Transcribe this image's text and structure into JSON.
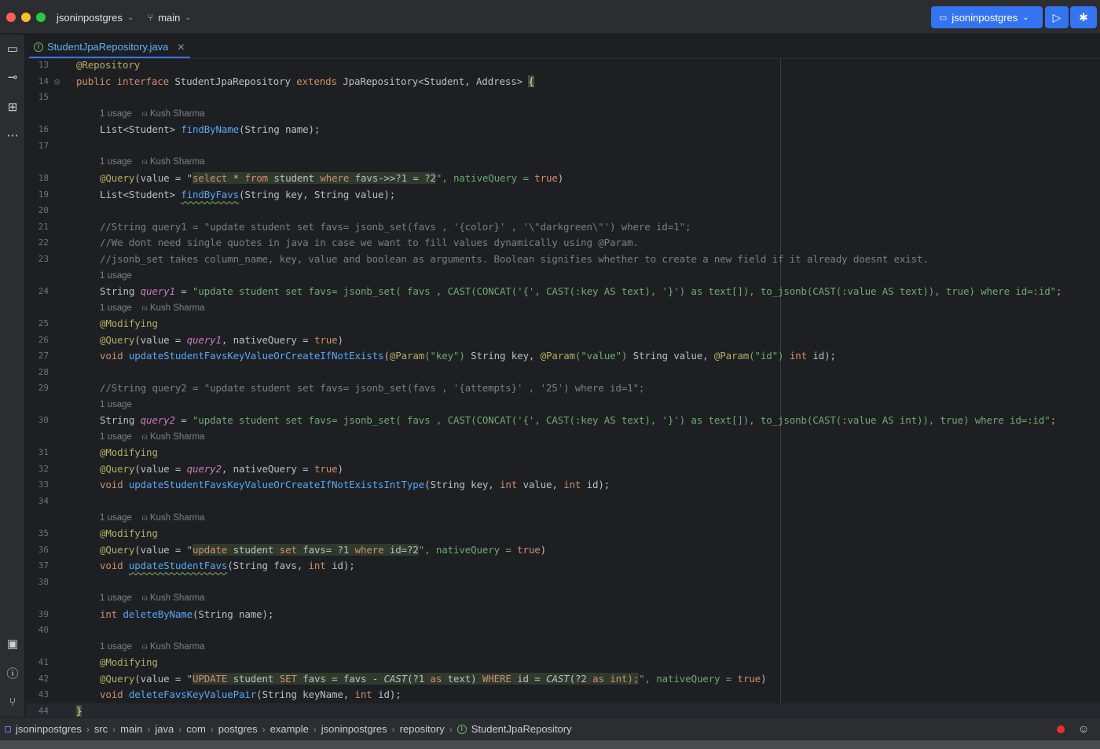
{
  "titlebar": {
    "project": "jsoninpostgres",
    "branch": "main",
    "run_config": "jsoninpostgres"
  },
  "tab": {
    "filename": "StudentJpaRepository.java"
  },
  "hints": {
    "usage": "1 usage",
    "author": "Kush Sharma"
  },
  "code": {
    "l13": "@Repository",
    "l14_kw1": "public interface ",
    "l14_name": "StudentJpaRepository ",
    "l14_kw2": "extends ",
    "l14_rest": "JpaRepository<Student, Address> ",
    "l14_brace": "{",
    "l16_a": "List<Student> ",
    "l16_fn": "findByName",
    "l16_b": "(String name);",
    "l18_ann": "@Query",
    "l18_a": "(value = \"",
    "l18_sql_kw1": "select",
    "l18_sql_1": " * ",
    "l18_sql_kw2": "from",
    "l18_sql_2": " student ",
    "l18_sql_kw3": "where",
    "l18_sql_3": " favs->>?1 = ?2",
    "l18_b": "\", nativeQuery = ",
    "l18_true": "true",
    "l18_c": ")",
    "l19_a": "List<Student> ",
    "l19_fn": "findByFavs",
    "l19_b": "(String key, String value);",
    "l21": "//String query1 = \"update student set favs= jsonb_set(favs , '{color}' , '\\\"darkgreen\\\"') where id=1\";",
    "l22": "//We dont need single quotes in java in case we want to fill values dynamically using @Param.",
    "l23": "//jsonb_set takes column_name, key, value and boolean as arguments. Boolean signifies whether to create a new field if it already doesnt exist.",
    "l24_a": "String ",
    "l24_var": "query1",
    "l24_b": " = ",
    "l24_str": "\"update student set favs= jsonb_set( favs , CAST(CONCAT('{', CAST(:key AS text), '}') as text[]), to_jsonb(CAST(:value AS text)), true) where id=:id\"",
    "l24_c": ";",
    "l25": "@Modifying",
    "l26_ann": "@Query",
    "l26_a": "(value = ",
    "l26_var": "query1",
    "l26_b": ", nativeQuery = ",
    "l26_true": "true",
    "l26_c": ")",
    "l27_kw": "void ",
    "l27_fn": "updateStudentFavsKeyValueOrCreateIfNotExists",
    "l27_a": "(",
    "l27_p1": "@Param",
    "l27_s1": "(\"key\")",
    "l27_b": " String key, ",
    "l27_p2": "@Param",
    "l27_s2": "(\"value\")",
    "l27_c": " String value, ",
    "l27_p3": "@Param",
    "l27_s3": "(\"id\")",
    "l27_d": " ",
    "l27_int": "int",
    "l27_e": " id);",
    "l29": "//String query2 = \"update student set favs= jsonb_set(favs , '{attempts}' , '25') where id=1\";",
    "l30_a": "String ",
    "l30_var": "query2",
    "l30_b": " = ",
    "l30_str": "\"update student set favs= jsonb_set( favs , CAST(CONCAT('{', CAST(:key AS text), '}') as text[]), to_jsonb(CAST(:value AS int)), true) where id=:id\"",
    "l30_c": ";",
    "l31": "@Modifying",
    "l32_ann": "@Query",
    "l32_a": "(value = ",
    "l32_var": "query2",
    "l32_b": ", nativeQuery = ",
    "l32_true": "true",
    "l32_c": ")",
    "l33_kw": "void ",
    "l33_fn": "updateStudentFavsKeyValueOrCreateIfNotExistsIntType",
    "l33_a": "(String key, ",
    "l33_int1": "int",
    "l33_b": " value, ",
    "l33_int2": "int",
    "l33_c": " id);",
    "l35": "@Modifying",
    "l36_ann": "@Query",
    "l36_a": "(value = \"",
    "l36_sql_kw1": "update",
    "l36_sql_1": " student ",
    "l36_sql_kw2": "set",
    "l36_sql_2": " favs= ?1 ",
    "l36_sql_kw3": "where",
    "l36_sql_3": " id=?2",
    "l36_b": "\", nativeQuery = ",
    "l36_true": "true",
    "l36_c": ")",
    "l37_kw": "void ",
    "l37_fn": "updateStudentFavs",
    "l37_a": "(String favs, ",
    "l37_int": "int",
    "l37_b": " id);",
    "l39_kw": "int ",
    "l39_fn": "deleteByName",
    "l39_a": "(String name);",
    "l41": "@Modifying",
    "l42_ann": "@Query",
    "l42_a": "(value = \"",
    "l42_sql_kw1": "UPDATE",
    "l42_sql_1": " student ",
    "l42_sql_kw2": "SET",
    "l42_sql_2": " favs = favs - ",
    "l42_sql_fn1": "CAST",
    "l42_sql_3": "(?1 ",
    "l42_sql_kw3": "as",
    "l42_sql_4": " text) ",
    "l42_sql_kw4": "WHERE",
    "l42_sql_5": " id = ",
    "l42_sql_fn2": "CAST",
    "l42_sql_6": "(?2 ",
    "l42_sql_kw5": "as",
    "l42_sql_7": " ",
    "l42_sql_kw6": "int",
    "l42_sql_8": ");",
    "l42_b": "\", nativeQuery = ",
    "l42_true": "true",
    "l42_c": ")",
    "l43_kw": "void ",
    "l43_fn": "deleteFavsKeyValuePair",
    "l43_a": "(String keyName, ",
    "l43_int": "int",
    "l43_b": " id);",
    "l44": "}"
  },
  "line_numbers": {
    "n13": "13",
    "n14": "14",
    "n15": "15",
    "n16": "16",
    "n17": "17",
    "n18": "18",
    "n19": "19",
    "n20": "20",
    "n21": "21",
    "n22": "22",
    "n23": "23",
    "n24": "24",
    "n25": "25",
    "n26": "26",
    "n27": "27",
    "n28": "28",
    "n29": "29",
    "n30": "30",
    "n31": "31",
    "n32": "32",
    "n33": "33",
    "n34": "34",
    "n35": "35",
    "n36": "36",
    "n37": "37",
    "n38": "38",
    "n39": "39",
    "n40": "40",
    "n41": "41",
    "n42": "42",
    "n43": "43",
    "n44": "44"
  },
  "breadcrumbs": [
    "jsoninpostgres",
    "src",
    "main",
    "java",
    "com",
    "postgres",
    "example",
    "jsoninpostgres",
    "repository",
    "StudentJpaRepository"
  ],
  "colors": {
    "accent": "#3574f0",
    "keyword": "#cf8e6d",
    "annotation": "#b3ae60",
    "function": "#56a8f5",
    "string": "#6aab73",
    "comment": "#7a7e85"
  }
}
